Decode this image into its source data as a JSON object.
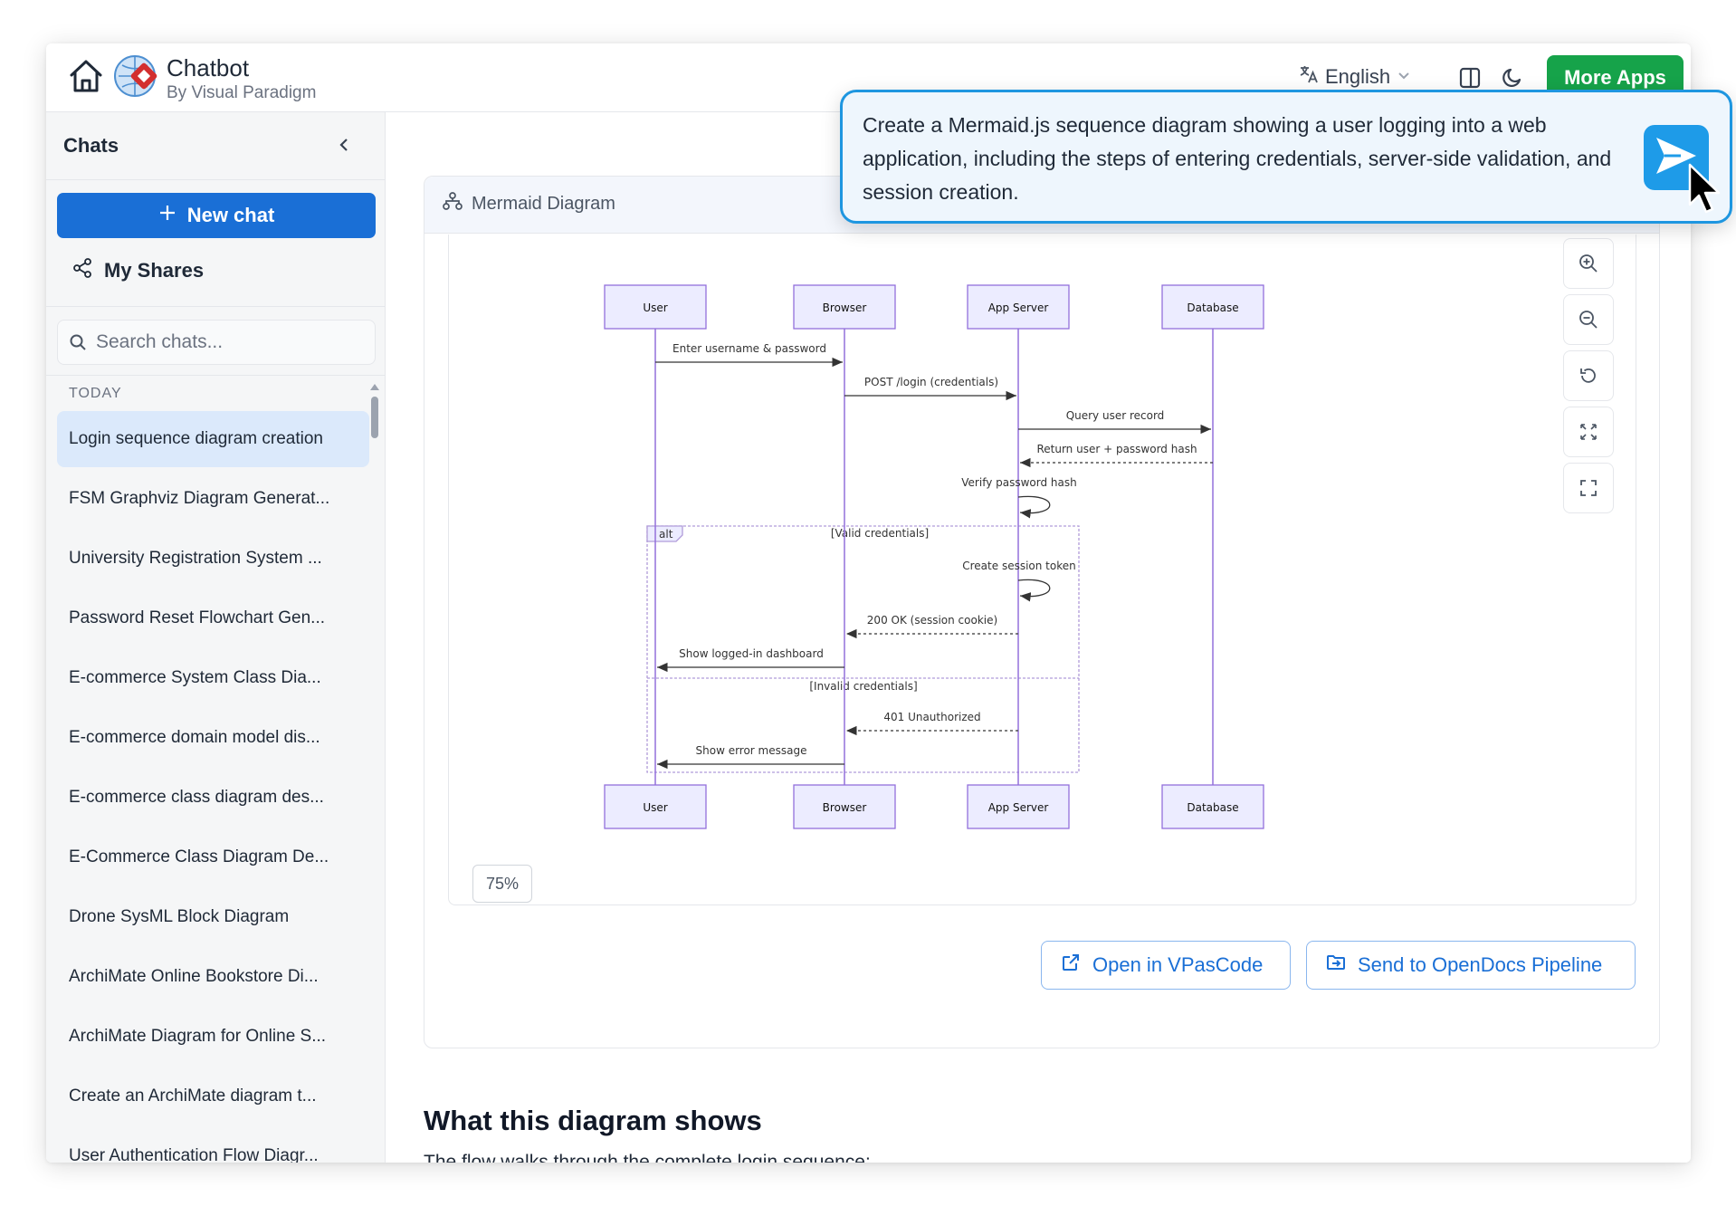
{
  "header": {
    "brand_name": "Chatbot",
    "brand_sub": "By Visual Paradigm",
    "language": "English",
    "more_apps": "More Apps"
  },
  "sidebar": {
    "title": "Chats",
    "new_chat": "New chat",
    "my_shares": "My Shares",
    "search_placeholder": "Search chats...",
    "section_label": "TODAY",
    "items": [
      "Login sequence diagram creation",
      "FSM Graphviz Diagram Generat...",
      "University Registration System ...",
      "Password Reset Flowchart Gen...",
      "E-commerce System Class Dia...",
      "E-commerce domain model dis...",
      "E-commerce class diagram des...",
      "E-Commerce Class Diagram De...",
      "Drone SysML Block Diagram",
      "ArchiMate Online Bookstore Di...",
      "ArchiMate Diagram for Online S...",
      "Create an ArchiMate diagram t...",
      "User Authentication Flow Diagr..."
    ]
  },
  "main": {
    "card_title": "Mermaid Diagram",
    "zoom_level": "75%",
    "open_button": "Open in VPasCode",
    "send_button": "Send to OpenDocs Pipeline",
    "section_title": "What this diagram shows",
    "section_text": "The flow walks through the complete login sequence:"
  },
  "diagram": {
    "participants": [
      "User",
      "Browser",
      "App Server",
      "Database"
    ],
    "messages": [
      "Enter username & password",
      "POST /login (credentials)",
      "Query user record",
      "Return user + password hash",
      "Verify password hash",
      "Create session token",
      "200 OK (session cookie)",
      "Show logged-in dashboard",
      "401 Unauthorized",
      "Show error message"
    ],
    "alt_label": "alt",
    "valid_guard": "[Valid credentials]",
    "invalid_guard": "[Invalid credentials]"
  },
  "prompt": {
    "text": "Create a Mermaid.js sequence diagram showing a user logging into a web application, including the steps of entering credentials, server-side validation, and session creation."
  },
  "colors": {
    "primary": "#1a6fd6",
    "more_apps": "#16a34a",
    "participant_fill": "#ececff",
    "participant_stroke": "#9370db"
  }
}
